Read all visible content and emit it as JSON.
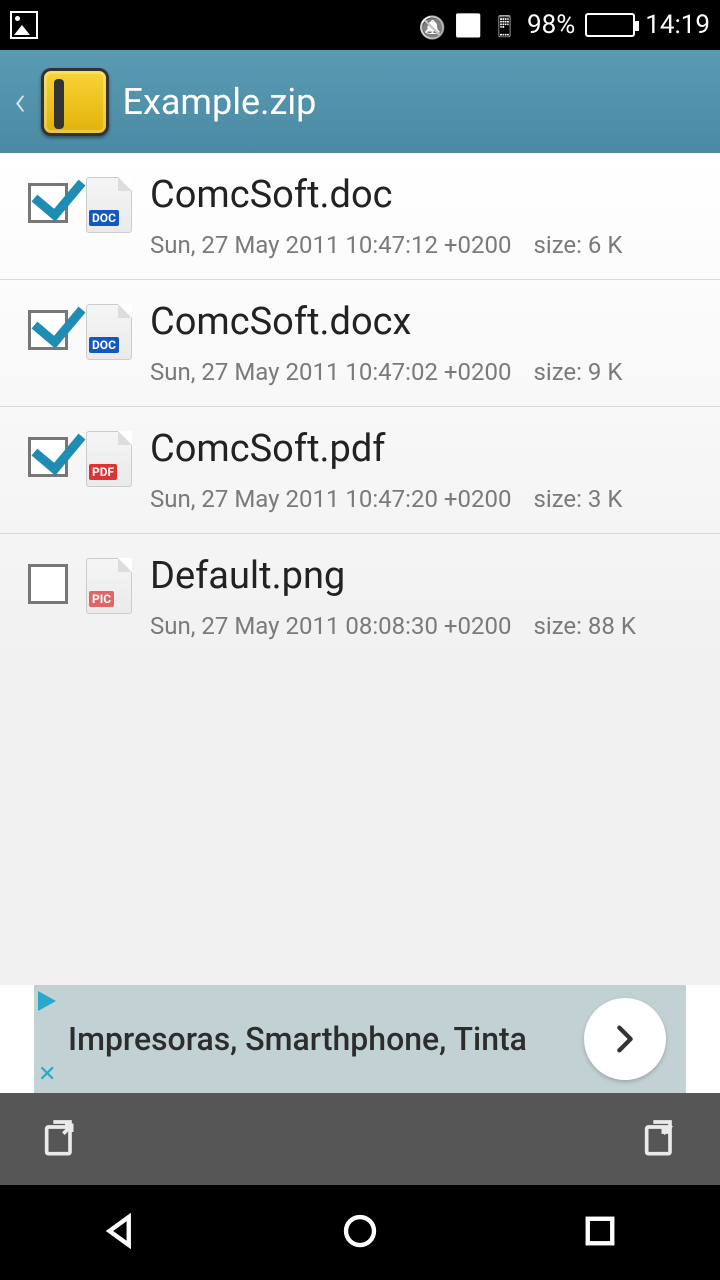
{
  "status": {
    "battery_pct": "98%",
    "time": "14:19"
  },
  "appbar": {
    "title": "Example.zip"
  },
  "files": [
    {
      "name": "ComcSoft.doc",
      "date": "Sun, 27 May 2011 10:47:12 +0200",
      "size": "size: 6 K",
      "checked": true,
      "badge": "DOC",
      "badge_kind": "doc"
    },
    {
      "name": "ComcSoft.docx",
      "date": "Sun, 27 May 2011 10:47:02 +0200",
      "size": "size: 9 K",
      "checked": true,
      "badge": "DOC",
      "badge_kind": "doc"
    },
    {
      "name": "ComcSoft.pdf",
      "date": "Sun, 27 May 2011 10:47:20 +0200",
      "size": "size: 3 K",
      "checked": true,
      "badge": "PDF",
      "badge_kind": "pdf"
    },
    {
      "name": "Default.png",
      "date": "Sun, 27 May 2011 08:08:30 +0200",
      "size": "size: 88 K",
      "checked": false,
      "badge": "PIC",
      "badge_kind": "pic"
    }
  ],
  "ad": {
    "text": "Impresoras, Smarthphone, Tinta"
  }
}
